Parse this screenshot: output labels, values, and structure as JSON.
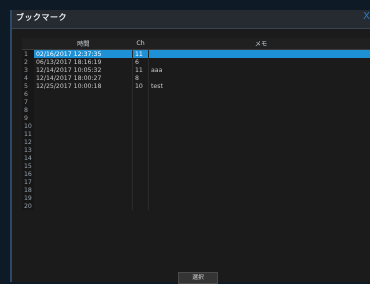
{
  "window": {
    "title": "ブックマーク",
    "close_symbol": "X"
  },
  "columns": {
    "time": "時間",
    "ch": "Ch",
    "memo": "メモ"
  },
  "rows": [
    {
      "n": "1",
      "time": "02/16/2017 12:37:35",
      "ch": "11",
      "memo": ""
    },
    {
      "n": "2",
      "time": "06/13/2017 18:16:19",
      "ch": "6",
      "memo": ""
    },
    {
      "n": "3",
      "time": "12/14/2017 10:05:32",
      "ch": "11",
      "memo": "aaa"
    },
    {
      "n": "4",
      "time": "12/14/2017 18:00:27",
      "ch": "8",
      "memo": ""
    },
    {
      "n": "5",
      "time": "12/25/2017 10:00:18",
      "ch": "10",
      "memo": "test"
    },
    {
      "n": "6",
      "time": "",
      "ch": "",
      "memo": ""
    },
    {
      "n": "7",
      "time": "",
      "ch": "",
      "memo": ""
    },
    {
      "n": "8",
      "time": "",
      "ch": "",
      "memo": ""
    },
    {
      "n": "9",
      "time": "",
      "ch": "",
      "memo": ""
    },
    {
      "n": "10",
      "time": "",
      "ch": "",
      "memo": ""
    },
    {
      "n": "11",
      "time": "",
      "ch": "",
      "memo": ""
    },
    {
      "n": "12",
      "time": "",
      "ch": "",
      "memo": ""
    },
    {
      "n": "13",
      "time": "",
      "ch": "",
      "memo": ""
    },
    {
      "n": "14",
      "time": "",
      "ch": "",
      "memo": ""
    },
    {
      "n": "15",
      "time": "",
      "ch": "",
      "memo": ""
    },
    {
      "n": "16",
      "time": "",
      "ch": "",
      "memo": ""
    },
    {
      "n": "17",
      "time": "",
      "ch": "",
      "memo": ""
    },
    {
      "n": "18",
      "time": "",
      "ch": "",
      "memo": ""
    },
    {
      "n": "19",
      "time": "",
      "ch": "",
      "memo": ""
    },
    {
      "n": "20",
      "time": "",
      "ch": "",
      "memo": ""
    }
  ],
  "selected_row": "1",
  "select_button": "選択"
}
